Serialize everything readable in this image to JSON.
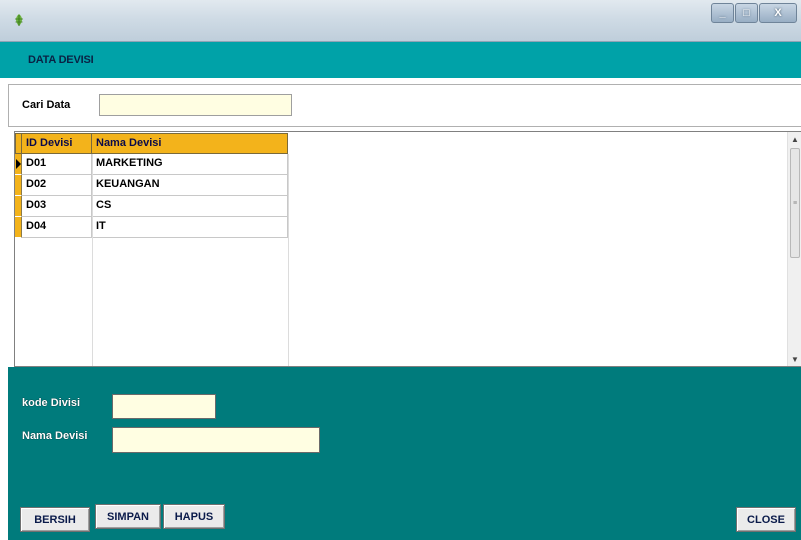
{
  "window": {
    "app_icon": "leaf-app-icon",
    "controls": {
      "minimize": "_",
      "maximize": "□",
      "close": "X"
    }
  },
  "header": {
    "title": "DATA DEVISI"
  },
  "search": {
    "label": "Cari Data",
    "value": "",
    "placeholder": ""
  },
  "grid": {
    "columns": [
      "ID Devisi",
      "Nama Devisi"
    ],
    "rows": [
      {
        "id": "D01",
        "nama": "MARKETING"
      },
      {
        "id": "D02",
        "nama": "KEUANGAN"
      },
      {
        "id": "D03",
        "nama": "CS"
      },
      {
        "id": "D04",
        "nama": "IT"
      }
    ],
    "selected_row": 0
  },
  "form": {
    "kode_label": "kode Divisi",
    "kode_value": "",
    "nama_label": "Nama Devisi",
    "nama_value": ""
  },
  "buttons": {
    "bersih": "BERSIH",
    "simpan": "SIMPAN",
    "hapus": "HAPUS",
    "close": "CLOSE"
  },
  "colors": {
    "header_bg": "#00a2a8",
    "form_bg": "#007b7c",
    "grid_header": "#f3b31b",
    "input_bg": "#fffee2"
  }
}
